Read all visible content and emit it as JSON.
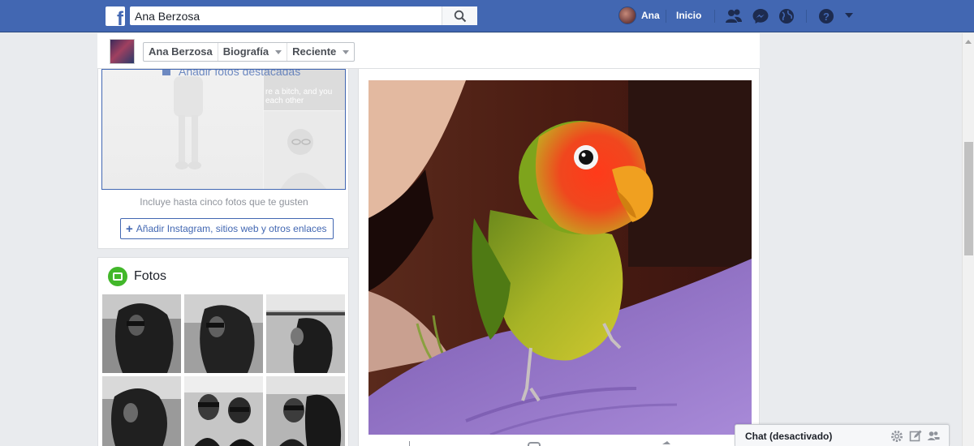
{
  "header": {
    "logo_letter": "f",
    "search_value": "Ana Berzosa",
    "user_name": "Ana",
    "home_label": "Inicio"
  },
  "timeline_nav": {
    "tabs": [
      {
        "label": "Ana Berzosa"
      },
      {
        "label": "Biografía"
      },
      {
        "label": "Reciente"
      }
    ]
  },
  "intro": {
    "add_featured_label": "Añadir fotos destacadas",
    "featured_caption": "re a bitch, and you\neach other",
    "hint": "Incluye hasta cinco fotos que te gusten",
    "add_links_label": "Añadir Instagram, sitios web y otros enlaces"
  },
  "photos": {
    "title": "Fotos",
    "items": [
      "photo-1",
      "photo-2",
      "photo-3",
      "photo-4",
      "photo-5",
      "photo-6"
    ]
  },
  "chat": {
    "label": "Chat (desactivado)"
  },
  "colors": {
    "brand_blue": "#4267b2",
    "page_bg": "#e9ebee",
    "photos_green": "#42b72a"
  }
}
